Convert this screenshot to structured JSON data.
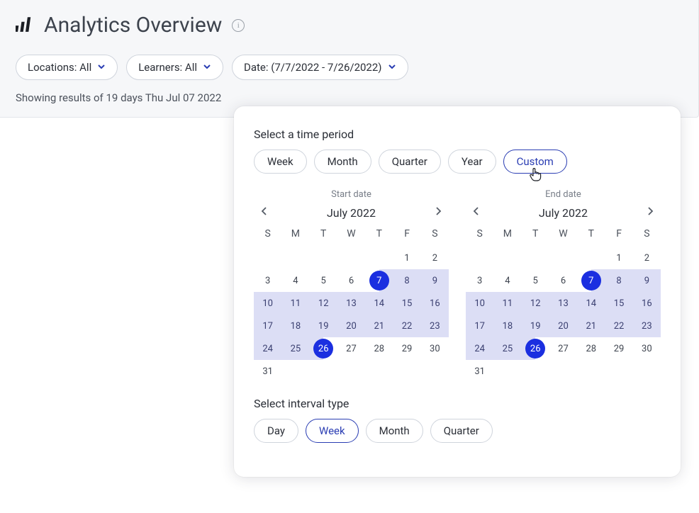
{
  "header": {
    "title": "Analytics Overview"
  },
  "filters": {
    "locations": "Locations: All",
    "learners": "Learners: All",
    "date": "Date: (7/7/2022 - 7/26/2022)"
  },
  "results_line": "Showing results of 19 days Thu Jul 07 2022",
  "popover": {
    "period_title": "Select a time period",
    "periods": [
      "Week",
      "Month",
      "Quarter",
      "Year",
      "Custom"
    ],
    "period_selected": "Custom",
    "interval_title": "Select interval type",
    "intervals": [
      "Day",
      "Week",
      "Month",
      "Quarter"
    ],
    "interval_selected": "Week",
    "start": {
      "label": "Start date",
      "month": "July 2022",
      "dow": [
        "S",
        "M",
        "T",
        "W",
        "T",
        "F",
        "S"
      ],
      "leading_blanks": 5,
      "days": 31,
      "range": [
        7,
        26
      ],
      "selected": [
        7,
        26
      ]
    },
    "end": {
      "label": "End date",
      "month": "July 2022",
      "dow": [
        "S",
        "M",
        "T",
        "W",
        "T",
        "F",
        "S"
      ],
      "leading_blanks": 5,
      "days": 31,
      "range": [
        7,
        26
      ],
      "selected": [
        7,
        26
      ]
    }
  }
}
